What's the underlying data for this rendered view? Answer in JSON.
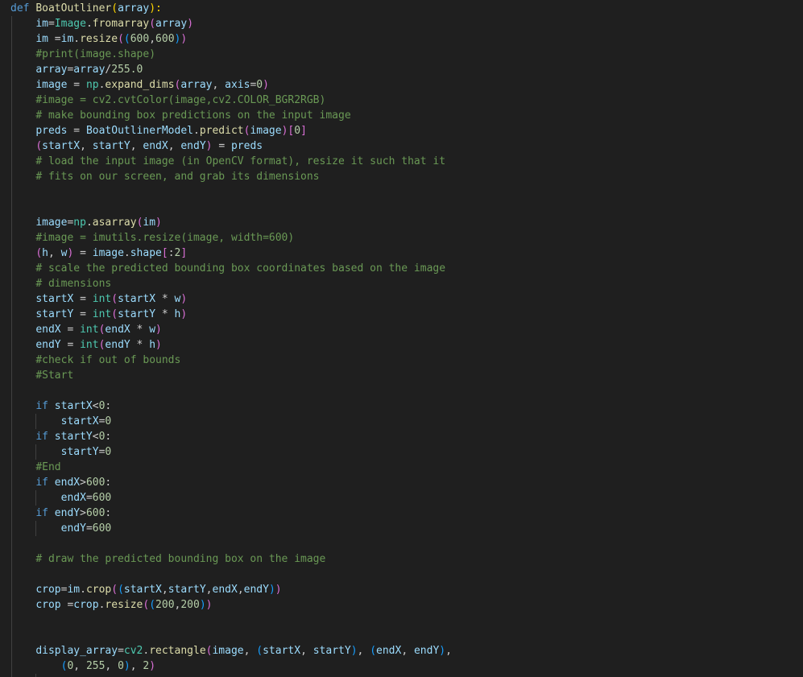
{
  "editor": {
    "colors": {
      "background": "#1f1f1f",
      "default": "#cccccc",
      "keyword": "#569cd6",
      "function": "#dcdcaa",
      "variable": "#9cdcfe",
      "class": "#4ec9b0",
      "string": "#ce9178",
      "number": "#b5cea8",
      "comment": "#6a9955",
      "bracket1": "#ffd700",
      "bracket2": "#da70d6",
      "bracket3": "#179fff",
      "indent_guide": "#404040"
    },
    "lines": [
      [
        [
          "def",
          "keyword"
        ],
        [
          " ",
          "default"
        ],
        [
          "BoatOutliner",
          "function"
        ],
        [
          "(",
          "bracket1"
        ],
        [
          "array",
          "variable"
        ],
        [
          "):",
          "bracket1"
        ]
      ],
      [
        [
          "    ",
          "default"
        ],
        [
          "im",
          "variable"
        ],
        [
          "=",
          "default"
        ],
        [
          "Image",
          "class"
        ],
        [
          ".",
          "default"
        ],
        [
          "fromarray",
          "function"
        ],
        [
          "(",
          "bracket2"
        ],
        [
          "array",
          "variable"
        ],
        [
          ")",
          "bracket2"
        ]
      ],
      [
        [
          "    ",
          "default"
        ],
        [
          "im",
          "variable"
        ],
        [
          " =",
          "default"
        ],
        [
          "im",
          "variable"
        ],
        [
          ".",
          "default"
        ],
        [
          "resize",
          "function"
        ],
        [
          "(",
          "bracket2"
        ],
        [
          "(",
          "bracket3"
        ],
        [
          "600",
          "number"
        ],
        [
          ",",
          "default"
        ],
        [
          "600",
          "number"
        ],
        [
          ")",
          "bracket3"
        ],
        [
          ")",
          "bracket2"
        ]
      ],
      [
        [
          "    ",
          "default"
        ],
        [
          "#print(image.shape)",
          "comment"
        ]
      ],
      [
        [
          "    ",
          "default"
        ],
        [
          "array",
          "variable"
        ],
        [
          "=",
          "default"
        ],
        [
          "array",
          "variable"
        ],
        [
          "/",
          "default"
        ],
        [
          "255.0",
          "number"
        ]
      ],
      [
        [
          "    ",
          "default"
        ],
        [
          "image",
          "variable"
        ],
        [
          " = ",
          "default"
        ],
        [
          "np",
          "class"
        ],
        [
          ".",
          "default"
        ],
        [
          "expand_dims",
          "function"
        ],
        [
          "(",
          "bracket2"
        ],
        [
          "array",
          "variable"
        ],
        [
          ", ",
          "default"
        ],
        [
          "axis",
          "variable"
        ],
        [
          "=",
          "default"
        ],
        [
          "0",
          "number"
        ],
        [
          ")",
          "bracket2"
        ]
      ],
      [
        [
          "    ",
          "default"
        ],
        [
          "#image = cv2.cvtColor(image,cv2.COLOR_BGR2RGB)",
          "comment"
        ]
      ],
      [
        [
          "    ",
          "default"
        ],
        [
          "# make bounding box predictions on the input image",
          "comment"
        ]
      ],
      [
        [
          "    ",
          "default"
        ],
        [
          "preds",
          "variable"
        ],
        [
          " = ",
          "default"
        ],
        [
          "BoatOutlinerModel",
          "variable"
        ],
        [
          ".",
          "default"
        ],
        [
          "predict",
          "function"
        ],
        [
          "(",
          "bracket2"
        ],
        [
          "image",
          "variable"
        ],
        [
          ")",
          "bracket2"
        ],
        [
          "[",
          "bracket2"
        ],
        [
          "0",
          "number"
        ],
        [
          "]",
          "bracket2"
        ]
      ],
      [
        [
          "    ",
          "default"
        ],
        [
          "(",
          "bracket2"
        ],
        [
          "startX",
          "variable"
        ],
        [
          ", ",
          "default"
        ],
        [
          "startY",
          "variable"
        ],
        [
          ", ",
          "default"
        ],
        [
          "endX",
          "variable"
        ],
        [
          ", ",
          "default"
        ],
        [
          "endY",
          "variable"
        ],
        [
          ")",
          "bracket2"
        ],
        [
          " = ",
          "default"
        ],
        [
          "preds",
          "variable"
        ]
      ],
      [
        [
          "    ",
          "default"
        ],
        [
          "# load the input image (in OpenCV format), resize it such that it",
          "comment"
        ]
      ],
      [
        [
          "    ",
          "default"
        ],
        [
          "# fits on our screen, and grab its dimensions",
          "comment"
        ]
      ],
      [],
      [],
      [
        [
          "    ",
          "default"
        ],
        [
          "image",
          "variable"
        ],
        [
          "=",
          "default"
        ],
        [
          "np",
          "class"
        ],
        [
          ".",
          "default"
        ],
        [
          "asarray",
          "function"
        ],
        [
          "(",
          "bracket2"
        ],
        [
          "im",
          "variable"
        ],
        [
          ")",
          "bracket2"
        ]
      ],
      [
        [
          "    ",
          "default"
        ],
        [
          "#image = imutils.resize(image, width=600)",
          "comment"
        ]
      ],
      [
        [
          "    ",
          "default"
        ],
        [
          "(",
          "bracket2"
        ],
        [
          "h",
          "variable"
        ],
        [
          ", ",
          "default"
        ],
        [
          "w",
          "variable"
        ],
        [
          ")",
          "bracket2"
        ],
        [
          " = ",
          "default"
        ],
        [
          "image",
          "variable"
        ],
        [
          ".",
          "default"
        ],
        [
          "shape",
          "variable"
        ],
        [
          "[",
          "bracket2"
        ],
        [
          ":",
          "default"
        ],
        [
          "2",
          "number"
        ],
        [
          "]",
          "bracket2"
        ]
      ],
      [
        [
          "    ",
          "default"
        ],
        [
          "# scale the predicted bounding box coordinates based on the image",
          "comment"
        ]
      ],
      [
        [
          "    ",
          "default"
        ],
        [
          "# dimensions",
          "comment"
        ]
      ],
      [
        [
          "    ",
          "default"
        ],
        [
          "startX",
          "variable"
        ],
        [
          " = ",
          "default"
        ],
        [
          "int",
          "class"
        ],
        [
          "(",
          "bracket2"
        ],
        [
          "startX",
          "variable"
        ],
        [
          " * ",
          "default"
        ],
        [
          "w",
          "variable"
        ],
        [
          ")",
          "bracket2"
        ]
      ],
      [
        [
          "    ",
          "default"
        ],
        [
          "startY",
          "variable"
        ],
        [
          " = ",
          "default"
        ],
        [
          "int",
          "class"
        ],
        [
          "(",
          "bracket2"
        ],
        [
          "startY",
          "variable"
        ],
        [
          " * ",
          "default"
        ],
        [
          "h",
          "variable"
        ],
        [
          ")",
          "bracket2"
        ]
      ],
      [
        [
          "    ",
          "default"
        ],
        [
          "endX",
          "variable"
        ],
        [
          " = ",
          "default"
        ],
        [
          "int",
          "class"
        ],
        [
          "(",
          "bracket2"
        ],
        [
          "endX",
          "variable"
        ],
        [
          " * ",
          "default"
        ],
        [
          "w",
          "variable"
        ],
        [
          ")",
          "bracket2"
        ]
      ],
      [
        [
          "    ",
          "default"
        ],
        [
          "endY",
          "variable"
        ],
        [
          " = ",
          "default"
        ],
        [
          "int",
          "class"
        ],
        [
          "(",
          "bracket2"
        ],
        [
          "endY",
          "variable"
        ],
        [
          " * ",
          "default"
        ],
        [
          "h",
          "variable"
        ],
        [
          ")",
          "bracket2"
        ]
      ],
      [
        [
          "    ",
          "default"
        ],
        [
          "#check if out of bounds",
          "comment"
        ]
      ],
      [
        [
          "    ",
          "default"
        ],
        [
          "#Start",
          "comment"
        ]
      ],
      [],
      [
        [
          "    ",
          "default"
        ],
        [
          "if",
          "keyword"
        ],
        [
          " ",
          "default"
        ],
        [
          "startX",
          "variable"
        ],
        [
          "<",
          "default"
        ],
        [
          "0",
          "number"
        ],
        [
          ":",
          "default"
        ]
      ],
      [
        [
          "        ",
          "default"
        ],
        [
          "startX",
          "variable"
        ],
        [
          "=",
          "default"
        ],
        [
          "0",
          "number"
        ]
      ],
      [
        [
          "    ",
          "default"
        ],
        [
          "if",
          "keyword"
        ],
        [
          " ",
          "default"
        ],
        [
          "startY",
          "variable"
        ],
        [
          "<",
          "default"
        ],
        [
          "0",
          "number"
        ],
        [
          ":",
          "default"
        ]
      ],
      [
        [
          "        ",
          "default"
        ],
        [
          "startY",
          "variable"
        ],
        [
          "=",
          "default"
        ],
        [
          "0",
          "number"
        ]
      ],
      [
        [
          "    ",
          "default"
        ],
        [
          "#End",
          "comment"
        ]
      ],
      [
        [
          "    ",
          "default"
        ],
        [
          "if",
          "keyword"
        ],
        [
          " ",
          "default"
        ],
        [
          "endX",
          "variable"
        ],
        [
          ">",
          "default"
        ],
        [
          "600",
          "number"
        ],
        [
          ":",
          "default"
        ]
      ],
      [
        [
          "        ",
          "default"
        ],
        [
          "endX",
          "variable"
        ],
        [
          "=",
          "default"
        ],
        [
          "600",
          "number"
        ]
      ],
      [
        [
          "    ",
          "default"
        ],
        [
          "if",
          "keyword"
        ],
        [
          " ",
          "default"
        ],
        [
          "endY",
          "variable"
        ],
        [
          ">",
          "default"
        ],
        [
          "600",
          "number"
        ],
        [
          ":",
          "default"
        ]
      ],
      [
        [
          "        ",
          "default"
        ],
        [
          "endY",
          "variable"
        ],
        [
          "=",
          "default"
        ],
        [
          "600",
          "number"
        ]
      ],
      [],
      [
        [
          "    ",
          "default"
        ],
        [
          "# draw the predicted bounding box on the image",
          "comment"
        ]
      ],
      [],
      [
        [
          "    ",
          "default"
        ],
        [
          "crop",
          "variable"
        ],
        [
          "=",
          "default"
        ],
        [
          "im",
          "variable"
        ],
        [
          ".",
          "default"
        ],
        [
          "crop",
          "function"
        ],
        [
          "(",
          "bracket2"
        ],
        [
          "(",
          "bracket3"
        ],
        [
          "startX",
          "variable"
        ],
        [
          ",",
          "default"
        ],
        [
          "startY",
          "variable"
        ],
        [
          ",",
          "default"
        ],
        [
          "endX",
          "variable"
        ],
        [
          ",",
          "default"
        ],
        [
          "endY",
          "variable"
        ],
        [
          ")",
          "bracket3"
        ],
        [
          ")",
          "bracket2"
        ]
      ],
      [
        [
          "    ",
          "default"
        ],
        [
          "crop",
          "variable"
        ],
        [
          " =",
          "default"
        ],
        [
          "crop",
          "variable"
        ],
        [
          ".",
          "default"
        ],
        [
          "resize",
          "function"
        ],
        [
          "(",
          "bracket2"
        ],
        [
          "(",
          "bracket3"
        ],
        [
          "200",
          "number"
        ],
        [
          ",",
          "default"
        ],
        [
          "200",
          "number"
        ],
        [
          ")",
          "bracket3"
        ],
        [
          ")",
          "bracket2"
        ]
      ],
      [],
      [],
      [
        [
          "    ",
          "default"
        ],
        [
          "display_array",
          "variable"
        ],
        [
          "=",
          "default"
        ],
        [
          "cv2",
          "class"
        ],
        [
          ".",
          "default"
        ],
        [
          "rectangle",
          "function"
        ],
        [
          "(",
          "bracket2"
        ],
        [
          "image",
          "variable"
        ],
        [
          ", ",
          "default"
        ],
        [
          "(",
          "bracket3"
        ],
        [
          "startX",
          "variable"
        ],
        [
          ", ",
          "default"
        ],
        [
          "startY",
          "variable"
        ],
        [
          ")",
          "bracket3"
        ],
        [
          ", ",
          "default"
        ],
        [
          "(",
          "bracket3"
        ],
        [
          "endX",
          "variable"
        ],
        [
          ", ",
          "default"
        ],
        [
          "endY",
          "variable"
        ],
        [
          ")",
          "bracket3"
        ],
        [
          ",",
          "default"
        ]
      ],
      [
        [
          "        ",
          "default"
        ],
        [
          "(",
          "bracket3"
        ],
        [
          "0",
          "number"
        ],
        [
          ", ",
          "default"
        ],
        [
          "255",
          "number"
        ],
        [
          ", ",
          "default"
        ],
        [
          "0",
          "number"
        ],
        [
          ")",
          "bracket3"
        ],
        [
          ", ",
          "default"
        ],
        [
          "2",
          "number"
        ],
        [
          ")",
          "bracket2"
        ]
      ]
    ]
  }
}
